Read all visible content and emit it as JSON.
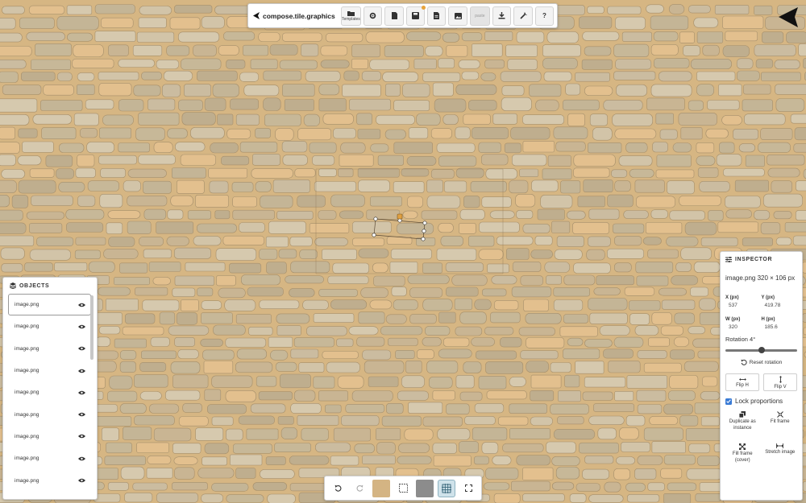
{
  "app": {
    "brand": "compose.tile.graphics"
  },
  "toolbar": {
    "templates_label": "Templates",
    "disabled_label": "paste"
  },
  "objects_panel": {
    "title": "OBJECTS",
    "items": [
      {
        "label": "image.png"
      },
      {
        "label": "image.png"
      },
      {
        "label": "image.png"
      },
      {
        "label": "image.png"
      },
      {
        "label": "image.png"
      },
      {
        "label": "image.png"
      },
      {
        "label": "image.png"
      },
      {
        "label": "image.png"
      },
      {
        "label": "image.png"
      }
    ]
  },
  "inspector": {
    "title": "INSPECTOR",
    "file_info": "image.png 320 × 106 px",
    "x_label": "X (px)",
    "x_value": "537",
    "y_label": "Y (px)",
    "y_value": "419.78",
    "w_label": "W (px)",
    "w_value": "320",
    "h_label": "H (px)",
    "h_value": "185.6",
    "rotation_label": "Rotation 4°",
    "rotation_fraction": 0.5,
    "reset_rotation": "Reset rotation",
    "flip_h": "Flip H",
    "flip_v": "Flip V",
    "lock_proportions": "Lock proportions",
    "duplicate_as_instance": "Duplicate as instance",
    "fit_frame": "Fit frame",
    "fill_frame_cover": "Fill frame (cover)",
    "stretch_image": "Stretch image"
  },
  "colors": {
    "canvas_background": "#d6b683",
    "swatch_fill": "#d4b483",
    "swatch_gray": "#8c8c8c",
    "accent": "#3a7bd5"
  }
}
